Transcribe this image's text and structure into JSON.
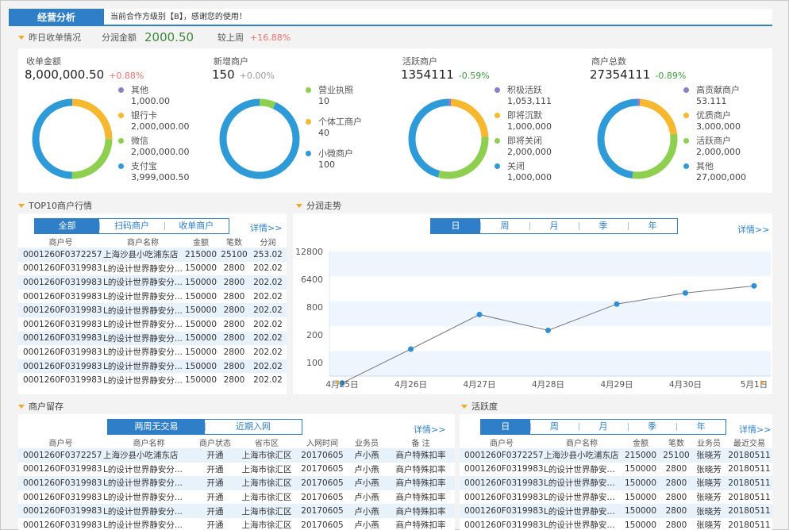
{
  "header": {
    "title": "经营分析",
    "notice": "当前合作方级别【B】，感谢您的使用！"
  },
  "yesterday": {
    "section": "昨日收单情况",
    "share_label": "分润金额",
    "share_value": "2000.50",
    "compare_label": "较上周",
    "compare_value": "+16.88%"
  },
  "cards": [
    {
      "title": "收单金额",
      "value": "8,000,000.50",
      "change": "+0.88%",
      "change_color": "#ef6e6e",
      "legend": [
        {
          "name": "其他",
          "value": "1,000.00",
          "color": "#8e7ccc"
        },
        {
          "name": "银行卡",
          "value": "2,000,000.00",
          "color": "#f5b82e"
        },
        {
          "name": "微信",
          "value": "2,000,000.00",
          "color": "#8ecf4f"
        },
        {
          "name": "支付宝",
          "value": "3,999,000.50",
          "color": "#2e9ad8"
        }
      ],
      "slices": [
        {
          "v": 1000,
          "color": "#8e7ccc"
        },
        {
          "v": 2000000,
          "color": "#f5b82e"
        },
        {
          "v": 2000000,
          "color": "#8ecf4f"
        },
        {
          "v": 3999000,
          "color": "#2e9ad8"
        }
      ]
    },
    {
      "title": "新增商户",
      "value": "150",
      "change": "+0.00%",
      "change_color": "#999999",
      "legend": [
        {
          "name": "营业执照",
          "value": "10",
          "color": "#8ecf4f"
        },
        {
          "name": "个体工商户",
          "value": "40",
          "color": "#f5b82e"
        },
        {
          "name": "小微商户",
          "value": "100",
          "color": "#2e9ad8"
        }
      ],
      "slices": [
        {
          "v": 10,
          "color": "#8ecf4f"
        },
        {
          "v": 0,
          "color": "#f5b82e"
        },
        {
          "v": 140,
          "color": "#2e9ad8"
        }
      ]
    },
    {
      "title": "活跃商户",
      "value": "1354111",
      "change": "-0.59%",
      "change_color": "#3c9a3c",
      "legend": [
        {
          "name": "积极活跃",
          "value": "1,053,111",
          "color": "#8e7ccc"
        },
        {
          "name": "即将沉默",
          "value": "1,000,000",
          "color": "#f5b82e"
        },
        {
          "name": "即将关闭",
          "value": "2,000,000",
          "color": "#8ecf4f"
        },
        {
          "name": "关闭",
          "value": "1,000,000",
          "color": "#2e9ad8"
        }
      ],
      "slices": [
        {
          "v": 80000,
          "color": "#8e7ccc"
        },
        {
          "v": 1600000,
          "color": "#f5b82e"
        },
        {
          "v": 2100000,
          "color": "#8ecf4f"
        },
        {
          "v": 3200000,
          "color": "#2e9ad8"
        }
      ]
    },
    {
      "title": "商户总数",
      "value": "27354111",
      "change": "-0.89%",
      "change_color": "#3c9a3c",
      "legend": [
        {
          "name": "高贡献商户",
          "value": "53.111",
          "color": "#8e7ccc"
        },
        {
          "name": "优质商户",
          "value": "3,000,000",
          "color": "#f5b82e"
        },
        {
          "name": "活跃商户",
          "value": "2,000,000",
          "color": "#8ecf4f"
        },
        {
          "name": "其他",
          "value": "27,000,000",
          "color": "#2e9ad8"
        }
      ],
      "slices": [
        {
          "v": 80000,
          "color": "#8e7ccc"
        },
        {
          "v": 1500000,
          "color": "#f5b82e"
        },
        {
          "v": 2000000,
          "color": "#8ecf4f"
        },
        {
          "v": 3300000,
          "color": "#2e9ad8"
        }
      ]
    }
  ],
  "top10": {
    "section": "TOP10商户行情",
    "tabs": [
      "全部",
      "扫码商户",
      "收单商户"
    ],
    "more": "详情>>",
    "columns": [
      "商户号",
      "商户名称",
      "金额",
      "笔数",
      "分润"
    ],
    "rows": [
      [
        "0001260F0372257",
        "上海沙县小吃浦东店",
        "215000",
        "25100",
        "253.02"
      ],
      [
        "0001260F0319983",
        "L的设计世界静安分...",
        "150000",
        "2800",
        "202.02"
      ],
      [
        "0001260F0319983",
        "L的设计世界静安分...",
        "150000",
        "2800",
        "202.02"
      ],
      [
        "0001260F0319983",
        "L的设计世界静安分...",
        "150000",
        "2800",
        "202.02"
      ],
      [
        "0001260F0319983",
        "L的设计世界静安分...",
        "150000",
        "2800",
        "202.02"
      ],
      [
        "0001260F0319983",
        "L的设计世界静安分...",
        "150000",
        "2800",
        "202.02"
      ],
      [
        "0001260F0319983",
        "L的设计世界静安分...",
        "150000",
        "2800",
        "202.02"
      ],
      [
        "0001260F0319983",
        "L的设计世界静安分...",
        "150000",
        "2800",
        "202.02"
      ],
      [
        "0001260F0319983",
        "L的设计世界静安分...",
        "150000",
        "2800",
        "202.02"
      ],
      [
        "0001260F0319983",
        "L的设计世界静安分...",
        "150000",
        "2800",
        "202.02"
      ]
    ]
  },
  "trend": {
    "section": "分润走势",
    "tabs": [
      "日",
      "周",
      "月",
      "季",
      "年"
    ],
    "more": "详情>>"
  },
  "chart_data": {
    "type": "line",
    "x": [
      "4月25日",
      "4月26日",
      "4月27日",
      "4月28日",
      "4月29日",
      "4月30日",
      "5月1日"
    ],
    "y_ticks": [
      "12800",
      "6400",
      "800",
      "200",
      "100"
    ],
    "series": [
      {
        "values": [
          60,
          140,
          550,
          250,
          1000,
          2300,
          3900
        ]
      }
    ]
  },
  "retention": {
    "section": "商户留存",
    "tabs": [
      "两周无交易",
      "近期入网"
    ],
    "more": "详情>>",
    "columns": [
      "商户号",
      "商户名称",
      "商户状态",
      "省市区",
      "入网时间",
      "业务员",
      "备 注"
    ],
    "rows": [
      [
        "0001260F0372257",
        "上海沙县小吃浦东店",
        "开通",
        "上海市徐汇区",
        "20170605",
        "卢小燕",
        "商户特殊扣率"
      ],
      [
        "0001260F0319983",
        "L的设计世界静安分...",
        "开通",
        "上海市徐汇区",
        "20170605",
        "卢小燕",
        "商户特殊扣率"
      ],
      [
        "0001260F0319983",
        "L的设计世界静安分...",
        "开通",
        "上海市徐汇区",
        "20170605",
        "卢小燕",
        "商户特殊扣率"
      ],
      [
        "0001260F0319983",
        "L的设计世界静安分...",
        "开通",
        "上海市徐汇区",
        "20170605",
        "卢小燕",
        "商户特殊扣率"
      ],
      [
        "0001260F0319983",
        "L的设计世界静安分...",
        "开通",
        "上海市徐汇区",
        "20170605",
        "卢小燕",
        "商户特殊扣率"
      ],
      [
        "0001260F0319983",
        "L的设计世界静安分...",
        "开通",
        "上海市徐汇区",
        "20170605",
        "卢小燕",
        "商户特殊扣率"
      ]
    ]
  },
  "activity": {
    "section": "活跃度",
    "tabs": [
      "日",
      "周",
      "月",
      "季",
      "年"
    ],
    "more": "详情>>",
    "columns": [
      "商户号",
      "商户名称",
      "金额",
      "笔数",
      "业务员",
      "最近交易"
    ],
    "rows": [
      [
        "0001260F0372257",
        "上海沙县小吃浦东店",
        "215000",
        "25100",
        "张晓芳",
        "20180511"
      ],
      [
        "0001260F0319983",
        "L的设计世界静安分...",
        "150000",
        "2800",
        "张晓芳",
        "20180511"
      ],
      [
        "0001260F0319983",
        "L的设计世界静安分...",
        "150000",
        "2800",
        "张晓芳",
        "20180511"
      ],
      [
        "0001260F0319983",
        "L的设计世界静安分...",
        "150000",
        "2800",
        "张晓芳",
        "20180511"
      ],
      [
        "0001260F0319983",
        "L的设计世界静安分...",
        "150000",
        "2800",
        "张晓芳",
        "20180511"
      ],
      [
        "0001260F0319983",
        "L的设计世界静安分...",
        "150000",
        "2800",
        "张晓芳",
        "20180511"
      ]
    ]
  }
}
